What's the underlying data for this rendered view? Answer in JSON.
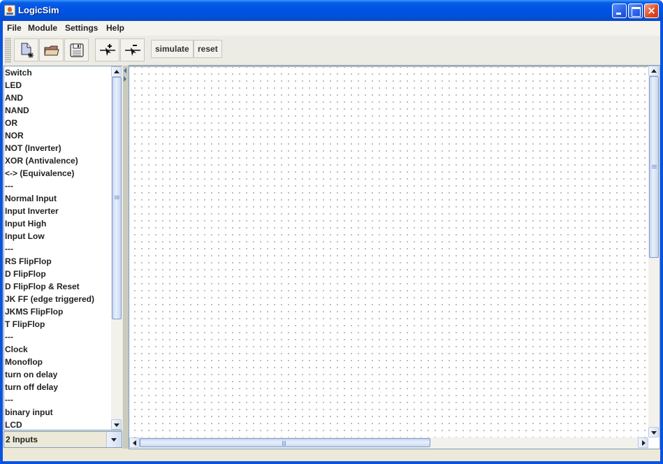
{
  "window": {
    "title": "LogicSim",
    "app_icon": "java-cup-icon",
    "controls": {
      "minimize": "minimize-icon",
      "maximize": "maximize-icon",
      "close": "×"
    }
  },
  "menubar": {
    "items": [
      {
        "label": "File"
      },
      {
        "label": "Module"
      },
      {
        "label": "Settings"
      },
      {
        "label": "Help"
      }
    ]
  },
  "toolbar": {
    "icon_buttons": [
      {
        "name": "new-file-icon"
      },
      {
        "name": "open-folder-icon"
      },
      {
        "name": "save-disk-icon"
      },
      {
        "name": "add-input-icon"
      },
      {
        "name": "remove-input-icon"
      }
    ],
    "simulate_label": "simulate",
    "reset_label": "reset"
  },
  "gate_list": {
    "items": [
      "Switch",
      "LED",
      "AND",
      "NAND",
      "OR",
      "NOR",
      "NOT (Inverter)",
      "XOR (Antivalence)",
      "<-> (Equivalence)",
      "---",
      "Normal Input",
      "Input Inverter",
      "Input High",
      "Input Low",
      "---",
      "RS FlipFlop",
      "D FlipFlop",
      "D FlipFlop & Reset",
      "JK FF (edge triggered)",
      "JKMS FlipFlop",
      "T FlipFlop",
      "---",
      "Clock",
      "Monoflop",
      "turn on delay",
      "turn off delay",
      "---",
      "binary input",
      "LCD"
    ],
    "scroll_position": 0.0,
    "visible_fraction": 0.74
  },
  "inputs_combo": {
    "selected": "2 Inputs"
  },
  "canvas": {
    "grid": "dotted",
    "vscroll": {
      "position": 0.0,
      "visible_fraction": 0.5
    },
    "hscroll": {
      "position": 0.0,
      "visible_fraction": 0.58
    }
  },
  "colors": {
    "titlebar": "#0054e3",
    "client_bg": "#ece9d8",
    "border_blue": "#7f9db9",
    "scroll_thumb": "#c4d4f0"
  }
}
